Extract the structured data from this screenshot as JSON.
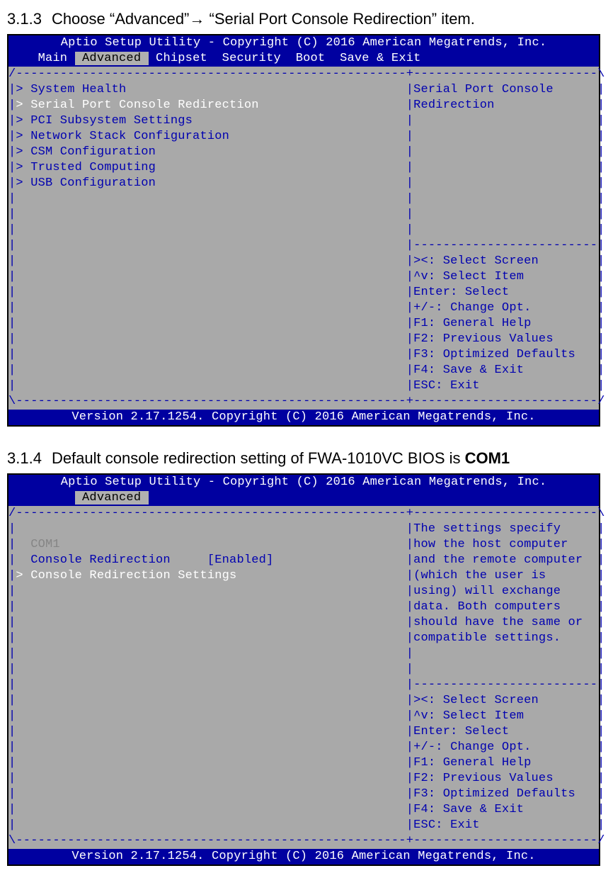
{
  "section1": {
    "number": "3.1.3",
    "text_a": "Choose “Advanced”",
    "arrow": "→",
    "text_b": " “Serial Port Console Redirection” item."
  },
  "section2": {
    "number": "3.1.4",
    "text_a": "Default console redirection setting of FWA-1010VC BIOS is ",
    "bold": "COM1"
  },
  "bios_common": {
    "title": "Aptio Setup Utility - Copyright (C) 2016 American Megatrends, Inc.",
    "footer": "Version 2.17.1254. Copyright (C) 2016 American Megatrends, Inc.",
    "sep_top": "/-----------------------------------------------------+-------------------------\\",
    "sep_mid": "|                                                     |-------------------------|",
    "sep_bot": "\\-----------------------------------------------------+-------------------------/",
    "help_lines": [
      "|                                                     |><: Select Screen        |",
      "|                                                     |^v: Select Item          |",
      "|                                                     |Enter: Select            |",
      "|                                                     |+/-: Change Opt.         |",
      "|                                                     |F1: General Help         |",
      "|                                                     |F2: Previous Values      |",
      "|                                                     |F3: Optimized Defaults   |",
      "|                                                     |F4: Save & Exit          |",
      "|                                                     |ESC: Exit                |"
    ]
  },
  "bios1": {
    "menubar_pre": "    Main ",
    "menubar_sel": " Advanced ",
    "menubar_post": " Chipset  Security  Boot  Save & Exit                        ",
    "right_desc": [
      "Serial Port Console",
      "Redirection"
    ],
    "items": [
      {
        "text": "> System Health",
        "pad": "                                      ",
        "selected": false
      },
      {
        "text": "> Serial Port Console Redirection",
        "pad": "                    ",
        "selected": true
      },
      {
        "text": "> PCI Subsystem Settings",
        "pad": "                             ",
        "selected": false
      },
      {
        "text": "> Network Stack Configuration",
        "pad": "                        ",
        "selected": false
      },
      {
        "text": "> CSM Configuration",
        "pad": "                                  ",
        "selected": false
      },
      {
        "text": "> Trusted Computing",
        "pad": "                                  ",
        "selected": false
      },
      {
        "text": "> USB Configuration",
        "pad": "                                  ",
        "selected": false
      }
    ],
    "blank_body": "|                                                     |                         |"
  },
  "bios2": {
    "menubar_pre": "         ",
    "menubar_sel": " Advanced ",
    "menubar_post": "                                                              ",
    "right_desc": [
      "The settings specify",
      "how the host computer",
      "and the remote computer",
      "(which the user is",
      "using) will exchange",
      "data. Both computers",
      "should have the same or",
      "compatible settings."
    ],
    "items": [
      {
        "raw": "|                                                     |",
        "selected": false
      },
      {
        "raw": "|  COM1                                               |",
        "selected": false,
        "dim": true
      },
      {
        "raw": "|  Console Redirection     [Enabled]                  |",
        "selected": false
      },
      {
        "raw": "|> Console Redirection Settings                       |",
        "selected": true
      }
    ],
    "blank_body": "|                                                     |                         |"
  }
}
